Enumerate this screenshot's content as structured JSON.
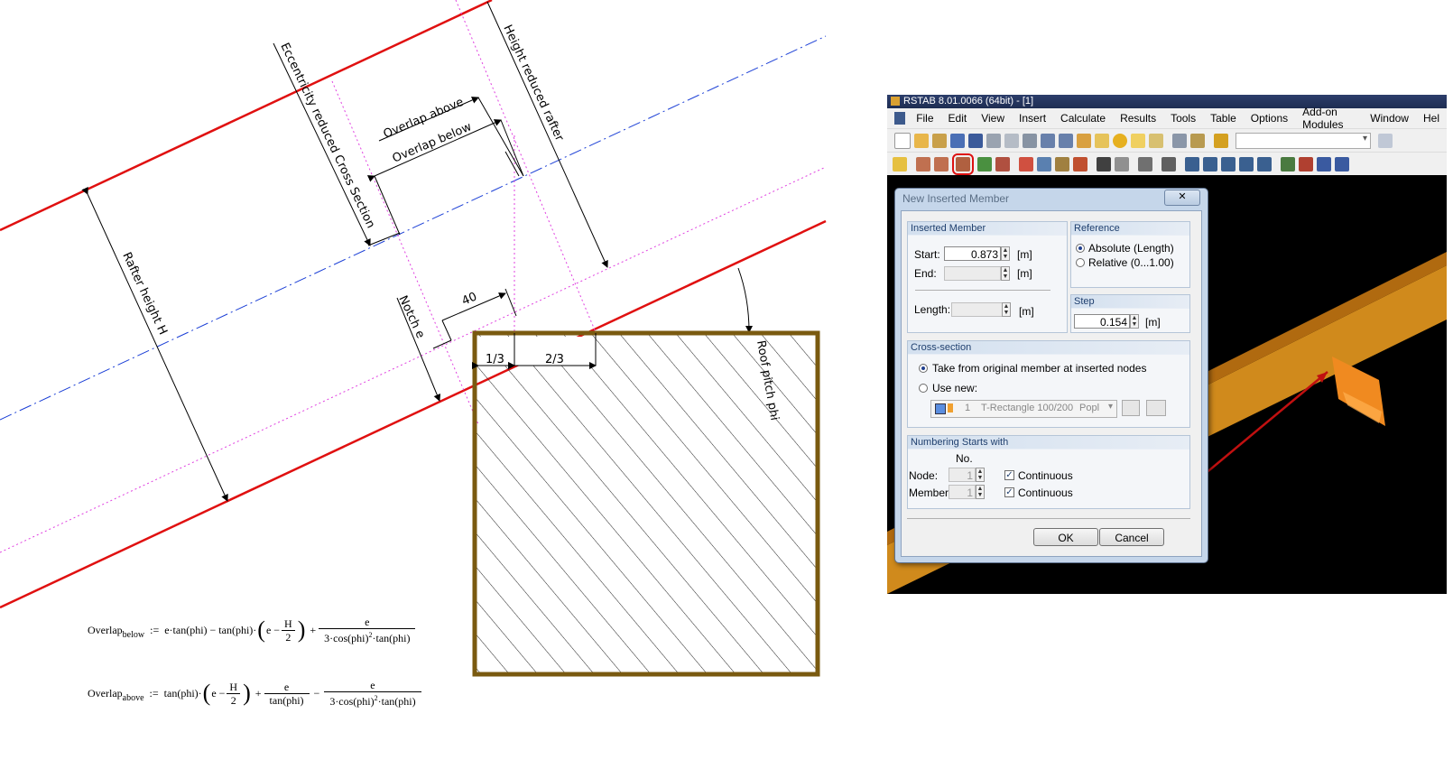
{
  "drawing": {
    "labels": {
      "eccentricity": "Eccentricity reduced Cross Section",
      "height_reduced": "Height reduced rafter",
      "overlap_above": "Overlap above",
      "overlap_below": "Overlap below",
      "rafter_height": "Rafter height H",
      "notch": "Notch e",
      "dim_40": "40",
      "third_1": "1/3",
      "third_2": "2/3",
      "roof_pitch": "Roof pitch phi"
    },
    "colors": {
      "rafter": "#e01010",
      "axis": "#1b3fd6",
      "guide": "#e040e0",
      "column": "#7a5a10"
    }
  },
  "formulas": {
    "below": {
      "lhs": "Overlap",
      "lhs_sub": "below",
      "assign": ":=",
      "t1": "e·tan(phi) − tan(phi)·",
      "inner": "e −",
      "H": "H",
      "two": "2",
      "plus": "+",
      "num": "e",
      "den": "3·cos(phi)",
      "den_exp": "2",
      "den_tail": "·tan(phi)"
    },
    "above": {
      "lhs": "Overlap",
      "lhs_sub": "above",
      "assign": ":=",
      "t1": "tan(phi)·",
      "inner": "e −",
      "H": "H",
      "two": "2",
      "plus": "+",
      "num1": "e",
      "den1": "tan(phi)",
      "minus": "−",
      "num2": "e",
      "den2": "3·cos(phi)",
      "den2_exp": "2",
      "den2_tail": "·tan(phi)"
    }
  },
  "app": {
    "title": "RSTAB 8.01.0066 (64bit) - [1]",
    "menu": [
      "File",
      "Edit",
      "View",
      "Insert",
      "Calculate",
      "Results",
      "Tools",
      "Table",
      "Options",
      "Add-on Modules",
      "Window",
      "Hel"
    ]
  },
  "dialog": {
    "title": "New Inserted Member",
    "close": "✕",
    "inserted_member": {
      "title": "Inserted Member",
      "start_label": "Start:",
      "start_value": "0.873",
      "start_unit": "[m]",
      "end_label": "End:",
      "end_value": "",
      "end_unit": "[m]",
      "length_label": "Length:",
      "length_value": "",
      "length_unit": "[m]"
    },
    "reference": {
      "title": "Reference",
      "absolute": "Absolute (Length)",
      "relative": "Relative (0...1.00)",
      "selected": "absolute"
    },
    "step": {
      "title": "Step",
      "value": "0.154",
      "unit": "[m]"
    },
    "cross_section": {
      "title": "Cross-section",
      "take_from": "Take from original member at inserted nodes",
      "use_new": "Use new:",
      "selected": "take_from",
      "combo_no": "1",
      "combo_name": "T-Rectangle 100/200",
      "combo_material": "Popl"
    },
    "numbering": {
      "title": "Numbering Starts with",
      "no_header": "No.",
      "node_label": "Node:",
      "node_value": "1",
      "member_label": "Member:",
      "member_value": "1",
      "continuous": "Continuous",
      "node_continuous": true,
      "member_continuous": true
    },
    "ok": "OK",
    "cancel": "Cancel"
  }
}
